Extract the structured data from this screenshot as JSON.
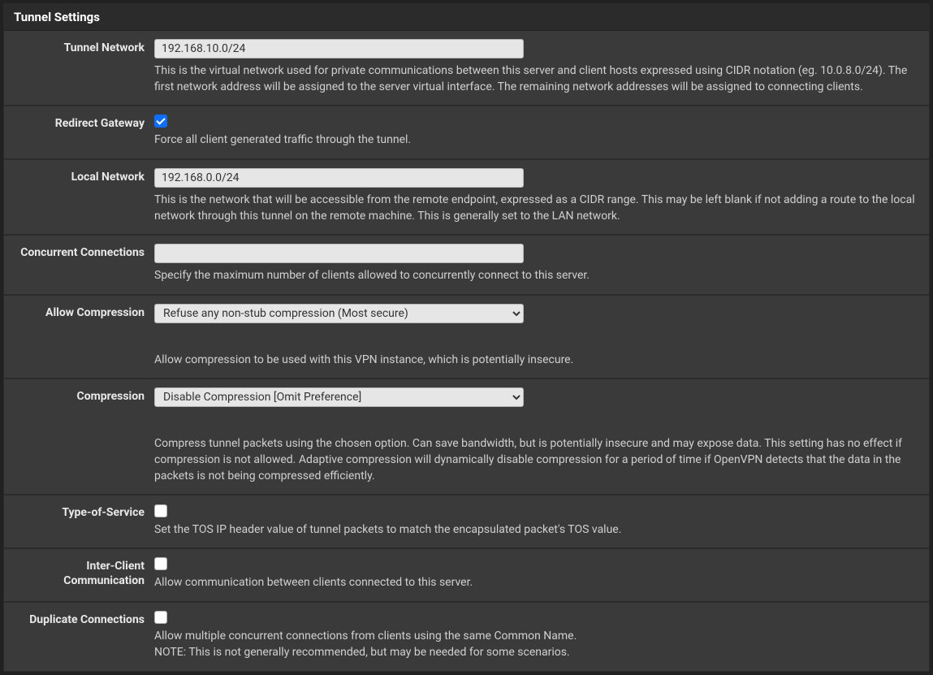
{
  "panel": {
    "title": "Tunnel Settings"
  },
  "rows": {
    "tunnel_network": {
      "label": "Tunnel Network",
      "value": "192.168.10.0/24",
      "help": "This is the virtual network used for private communications between this server and client hosts expressed using CIDR notation (eg. 10.0.8.0/24). The first network address will be assigned to the server virtual interface. The remaining network addresses will be assigned to connecting clients."
    },
    "redirect_gateway": {
      "label": "Redirect Gateway",
      "checked": true,
      "help": "Force all client generated traffic through the tunnel."
    },
    "local_network": {
      "label": "Local Network",
      "value": "192.168.0.0/24",
      "help": "This is the network that will be accessible from the remote endpoint, expressed as a CIDR range. This may be left blank if not adding a route to the local network through this tunnel on the remote machine. This is generally set to the LAN network."
    },
    "concurrent_connections": {
      "label": "Concurrent Connections",
      "value": "",
      "help": "Specify the maximum number of clients allowed to concurrently connect to this server."
    },
    "allow_compression": {
      "label": "Allow Compression",
      "selected": "Refuse any non-stub compression (Most secure)",
      "help": "Allow compression to be used with this VPN instance, which is potentially insecure."
    },
    "compression": {
      "label": "Compression",
      "selected": "Disable Compression [Omit Preference]",
      "help": "Compress tunnel packets using the chosen option. Can save bandwidth, but is potentially insecure and may expose data. This setting has no effect if compression is not allowed. Adaptive compression will dynamically disable compression for a period of time if OpenVPN detects that the data in the packets is not being compressed efficiently."
    },
    "type_of_service": {
      "label": "Type-of-Service",
      "checked": false,
      "help": "Set the TOS IP header value of tunnel packets to match the encapsulated packet's TOS value."
    },
    "inter_client": {
      "label": "Inter-Client Communication",
      "checked": false,
      "help": "Allow communication between clients connected to this server."
    },
    "duplicate_connections": {
      "label": "Duplicate Connections",
      "checked": false,
      "help_line1": "Allow multiple concurrent connections from clients using the same Common Name.",
      "help_line2": "NOTE: This is not generally recommended, but may be needed for some scenarios."
    }
  }
}
